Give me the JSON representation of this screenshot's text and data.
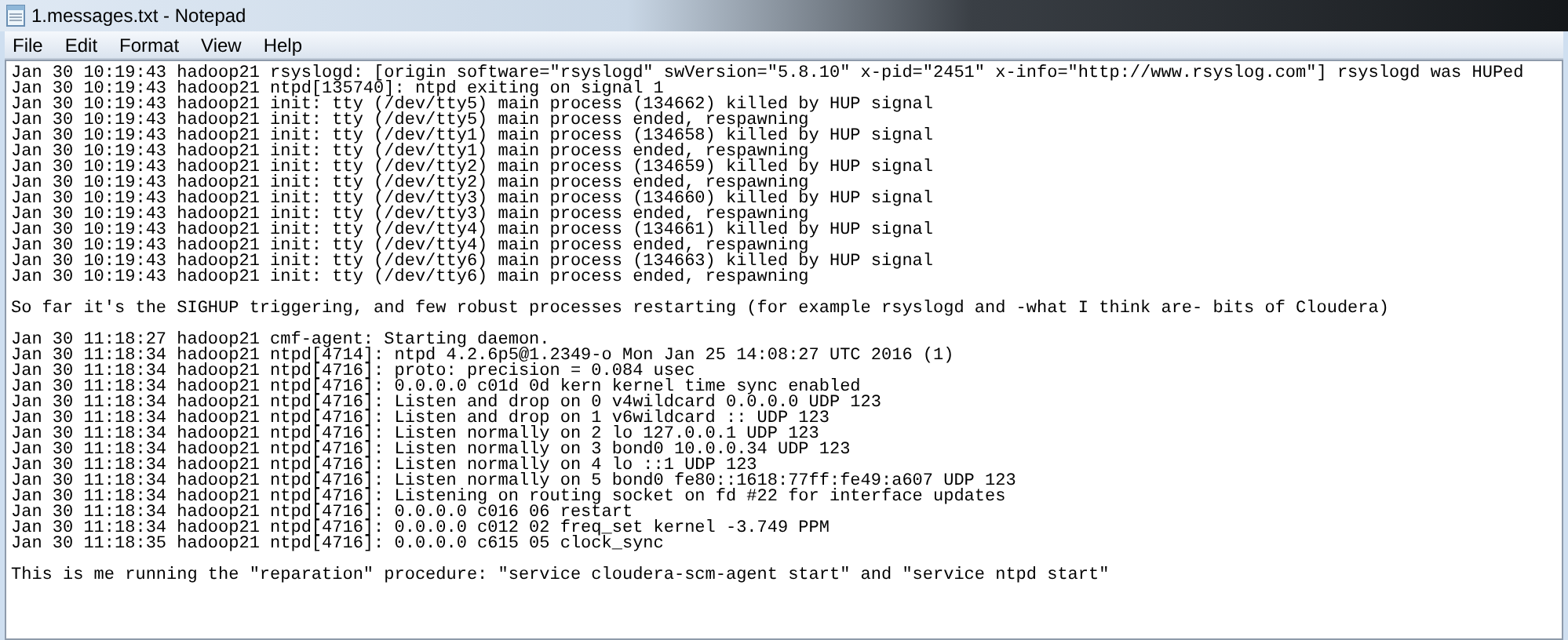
{
  "window": {
    "title": "1.messages.txt - Notepad"
  },
  "menu": [
    {
      "label": "File"
    },
    {
      "label": "Edit"
    },
    {
      "label": "Format"
    },
    {
      "label": "View"
    },
    {
      "label": "Help"
    }
  ],
  "blocks": [
    {
      "lines": [
        "Jan 30 10:19:43 hadoop21 rsyslogd: [origin software=\"rsyslogd\" swVersion=\"5.8.10\" x-pid=\"2451\" x-info=\"http://www.rsyslog.com\"] rsyslogd was HUPed",
        "Jan 30 10:19:43 hadoop21 ntpd[135740]: ntpd exiting on signal 1",
        "Jan 30 10:19:43 hadoop21 init: tty (/dev/tty5) main process (134662) killed by HUP signal",
        "Jan 30 10:19:43 hadoop21 init: tty (/dev/tty5) main process ended, respawning",
        "Jan 30 10:19:43 hadoop21 init: tty (/dev/tty1) main process (134658) killed by HUP signal",
        "Jan 30 10:19:43 hadoop21 init: tty (/dev/tty1) main process ended, respawning",
        "Jan 30 10:19:43 hadoop21 init: tty (/dev/tty2) main process (134659) killed by HUP signal",
        "Jan 30 10:19:43 hadoop21 init: tty (/dev/tty2) main process ended, respawning",
        "Jan 30 10:19:43 hadoop21 init: tty (/dev/tty3) main process (134660) killed by HUP signal",
        "Jan 30 10:19:43 hadoop21 init: tty (/dev/tty3) main process ended, respawning",
        "Jan 30 10:19:43 hadoop21 init: tty (/dev/tty4) main process (134661) killed by HUP signal",
        "Jan 30 10:19:43 hadoop21 init: tty (/dev/tty4) main process ended, respawning",
        "Jan 30 10:19:43 hadoop21 init: tty (/dev/tty6) main process (134663) killed by HUP signal",
        "Jan 30 10:19:43 hadoop21 init: tty (/dev/tty6) main process ended, respawning"
      ]
    },
    {
      "lines": [
        "So far it's the SIGHUP triggering, and few robust processes restarting (for example rsyslogd and -what I think are- bits of Cloudera)"
      ]
    },
    {
      "lines": [
        "Jan 30 11:18:27 hadoop21 cmf-agent: Starting daemon.",
        "Jan 30 11:18:34 hadoop21 ntpd[4714]: ntpd 4.2.6p5@1.2349-o Mon Jan 25 14:08:27 UTC 2016 (1)",
        "Jan 30 11:18:34 hadoop21 ntpd[4716]: proto: precision = 0.084 usec",
        "Jan 30 11:18:34 hadoop21 ntpd[4716]: 0.0.0.0 c01d 0d kern kernel time sync enabled",
        "Jan 30 11:18:34 hadoop21 ntpd[4716]: Listen and drop on 0 v4wildcard 0.0.0.0 UDP 123",
        "Jan 30 11:18:34 hadoop21 ntpd[4716]: Listen and drop on 1 v6wildcard :: UDP 123",
        "Jan 30 11:18:34 hadoop21 ntpd[4716]: Listen normally on 2 lo 127.0.0.1 UDP 123",
        "Jan 30 11:18:34 hadoop21 ntpd[4716]: Listen normally on 3 bond0 10.0.0.34 UDP 123",
        "Jan 30 11:18:34 hadoop21 ntpd[4716]: Listen normally on 4 lo ::1 UDP 123",
        "Jan 30 11:18:34 hadoop21 ntpd[4716]: Listen normally on 5 bond0 fe80::1618:77ff:fe49:a607 UDP 123",
        "Jan 30 11:18:34 hadoop21 ntpd[4716]: Listening on routing socket on fd #22 for interface updates",
        "Jan 30 11:18:34 hadoop21 ntpd[4716]: 0.0.0.0 c016 06 restart",
        "Jan 30 11:18:34 hadoop21 ntpd[4716]: 0.0.0.0 c012 02 freq_set kernel -3.749 PPM",
        "Jan 30 11:18:35 hadoop21 ntpd[4716]: 0.0.0.0 c615 05 clock_sync"
      ]
    },
    {
      "lines": [
        "This is me running the \"reparation\" procedure: \"service cloudera-scm-agent start\" and \"service ntpd start\""
      ]
    }
  ]
}
